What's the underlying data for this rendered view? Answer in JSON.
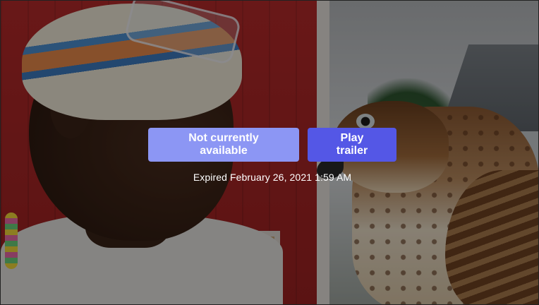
{
  "hero": {
    "image_subject": "man-and-hawk"
  },
  "actions": {
    "unavailable_label": "Not currently available",
    "trailer_label": "Play trailer"
  },
  "status": {
    "expired_text": "Expired February 26, 2021 1:59 AM"
  },
  "colors": {
    "unavailable_button": "#8c96f4",
    "trailer_button": "#5457e6",
    "text": "#ffffff"
  }
}
